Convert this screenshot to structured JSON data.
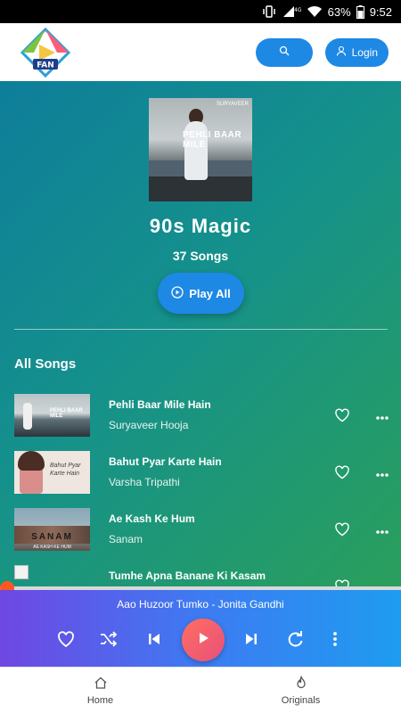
{
  "status_bar": {
    "network": "4G",
    "battery": "63%",
    "time": "9:52"
  },
  "header": {
    "logo_text": "FAN",
    "login_label": "Login"
  },
  "playlist": {
    "cover_title": "PEHLI BAAR MILE",
    "cover_brand": "SURYAVEER",
    "title": "90s Magic",
    "count": "37 Songs",
    "play_all_label": "Play All",
    "section_title": "All Songs"
  },
  "songs": [
    {
      "title": "Pehli Baar Mile Hain",
      "artist": "Suryaveer Hooja",
      "thumb_text": "PEHLI BAAR MILE"
    },
    {
      "title": "Bahut Pyar Karte Hain",
      "artist": "Varsha Tripathi",
      "thumb_text": "Bahut Pyar Karte Hain"
    },
    {
      "title": "Ae Kash Ke Hum",
      "artist": "Sanam",
      "thumb_text": "SANAM",
      "thumb_sub": "AE KASH KE HUM"
    },
    {
      "title": "Tumhe Apna Banane Ki Kasam",
      "artist": ""
    }
  ],
  "player": {
    "now_playing": "Aao Huzoor Tumko - Jonita Gandhi",
    "progress": 0.0
  },
  "bottom_nav": [
    {
      "label": "Home",
      "icon": "home-icon"
    },
    {
      "label": "Originals",
      "icon": "flame-icon"
    }
  ],
  "colors": {
    "accent": "#1e88e5",
    "progress": "#ff5722",
    "gradient_start": "#0e7e9a",
    "gradient_end": "#2a9f5c"
  }
}
